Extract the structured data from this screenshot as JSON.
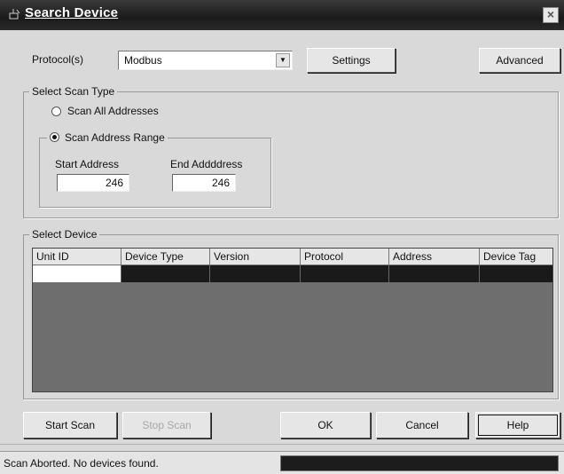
{
  "window": {
    "title": "Search Device",
    "close_label": "×"
  },
  "protocol": {
    "label": "Protocol(s)",
    "selected": "Modbus",
    "dropdown_arrow": "▼"
  },
  "buttons": {
    "settings": "Settings",
    "advanced": "Advanced",
    "start_scan": "Start Scan",
    "stop_scan": "Stop Scan",
    "ok": "OK",
    "cancel": "Cancel",
    "help": "Help"
  },
  "scan_type": {
    "group_title": "Select Scan Type",
    "option_all": "Scan All Addresses",
    "option_range": "Scan Address Range",
    "selected": "range",
    "start_address_label": "Start Address",
    "start_address_value": "246",
    "end_address_label": "End Addddress",
    "end_address_value": "246"
  },
  "device_table": {
    "group_title": "Select Device",
    "columns": [
      "Unit ID",
      "Device Type",
      "Version",
      "Protocol",
      "Address",
      "Device Tag"
    ],
    "rows": [
      [
        "",
        "",
        "",
        "",
        "",
        ""
      ]
    ]
  },
  "status": {
    "text": "Scan Aborted. No devices found.",
    "progress_fraction": 1.0
  },
  "colors": {
    "title_bar": "#1a1a1a",
    "dialog_bg": "#d9d9d9",
    "table_bg": "#6e6e6e",
    "progress": "#1c1c1c"
  }
}
